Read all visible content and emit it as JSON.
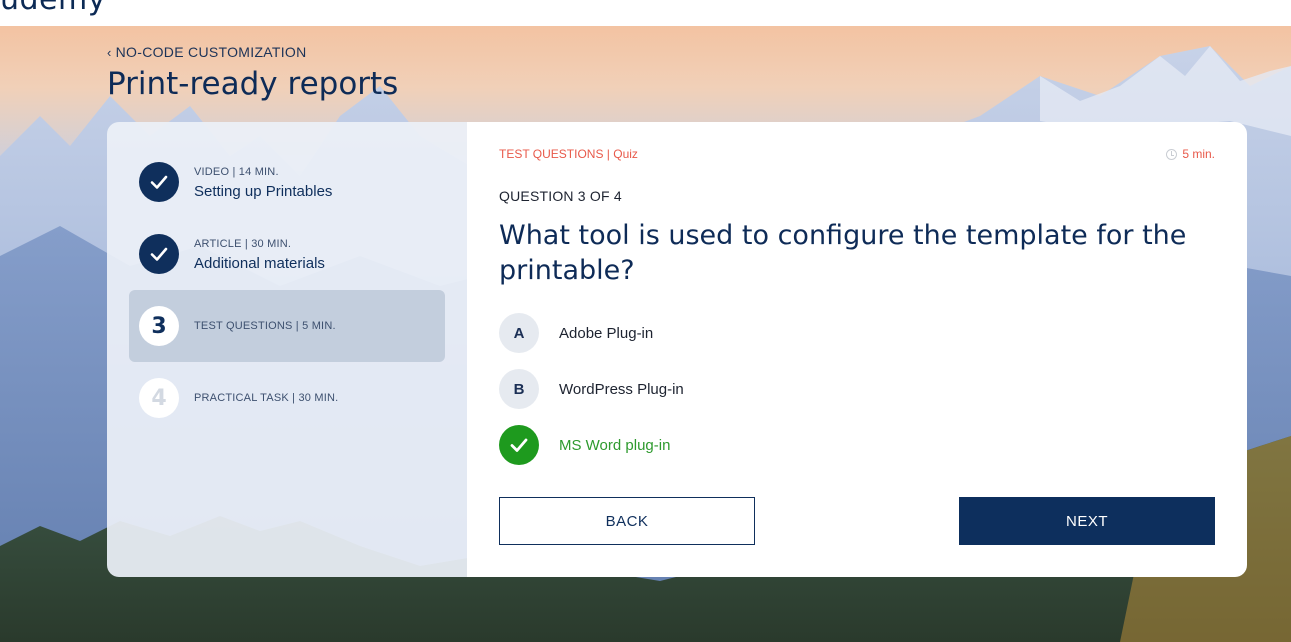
{
  "brand": {
    "logo_text": "udemy"
  },
  "breadcrumb": {
    "label": "NO-CODE CUSTOMIZATION"
  },
  "page": {
    "title": "Print-ready reports"
  },
  "steps": [
    {
      "status": "done",
      "meta": "VIDEO | 14 MIN.",
      "label": "Setting up Printables",
      "icon": "check-icon"
    },
    {
      "status": "done",
      "meta": "ARTICLE | 30 MIN.",
      "label": "Additional materials",
      "icon": "check-icon"
    },
    {
      "status": "current",
      "number": "3",
      "meta": "TEST QUESTIONS | 5 MIN."
    },
    {
      "status": "todo",
      "number": "4",
      "meta": "PRACTICAL TASK | 30 MIN."
    }
  ],
  "quiz": {
    "kicker": "TEST QUESTIONS | Quiz",
    "duration": "5 min.",
    "progress": "QUESTION 3 OF 4",
    "question": "What tool is used to configure the template for the printable?",
    "options": [
      {
        "letter": "A",
        "text": "Adobe Plug-in",
        "selected": false
      },
      {
        "letter": "B",
        "text": "WordPress Plug-in",
        "selected": false
      },
      {
        "letter": "",
        "text": "MS Word plug-in",
        "selected": true
      }
    ]
  },
  "actions": {
    "back_label": "BACK",
    "next_label": "NEXT"
  },
  "colors": {
    "primary": "#0d2f5d",
    "accent_red": "#e8594a",
    "correct_green": "#1e9a1e",
    "active_step_bg": "#c3cedd"
  }
}
